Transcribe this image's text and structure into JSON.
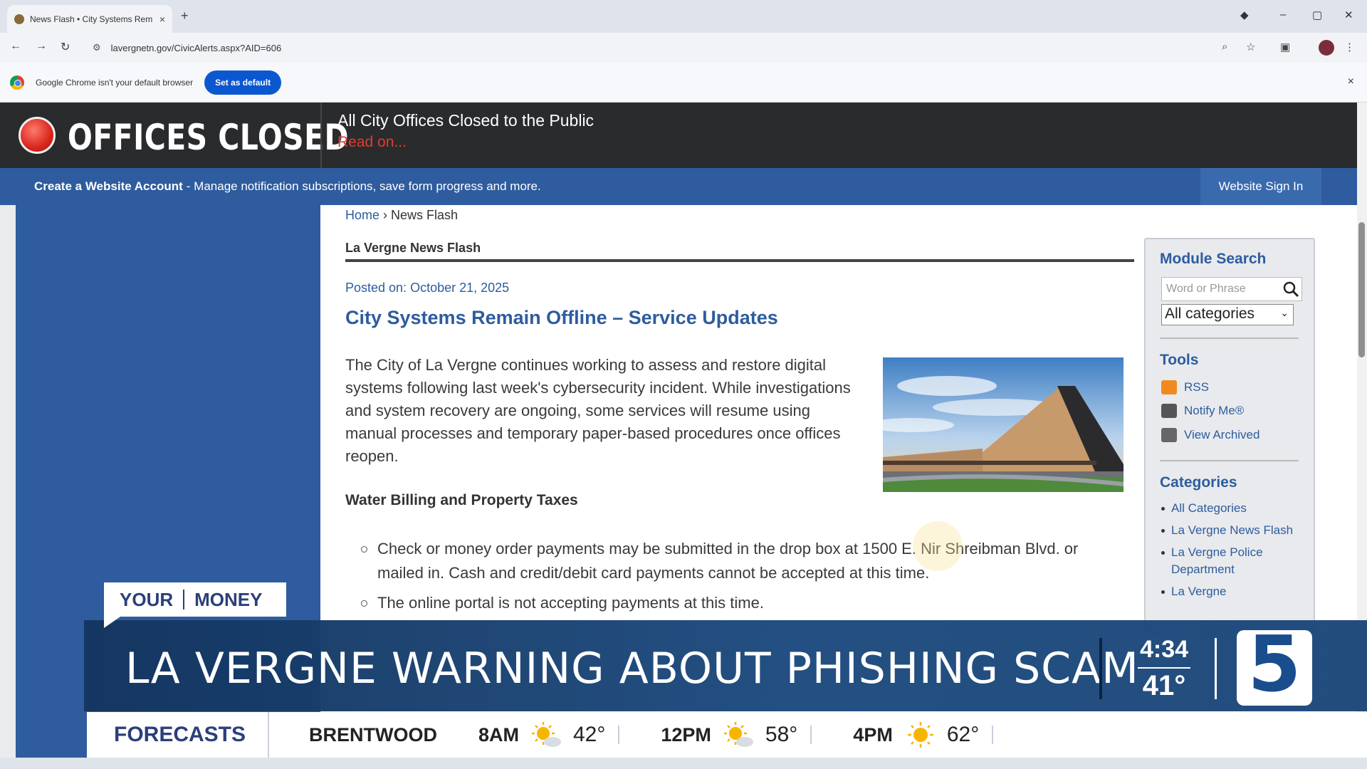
{
  "browser": {
    "tab_title": "News Flash • City Systems Rem",
    "tab_close": "×",
    "new_tab": "+",
    "url": "lavergnetn.gov/CivicAlerts.aspx?AID=606",
    "infobar_message": "Google Chrome isn't your default browser",
    "infobar_button": "Set as default",
    "infobar_close": "×"
  },
  "alert": {
    "title": "OFFICES CLOSED",
    "headline": "All City Offices Closed to the Public",
    "read_on": "Read on..."
  },
  "account_bar": {
    "create": "Create a Website Account",
    "description": "- Manage notification subscriptions, save form progress and more.",
    "sign_in": "Website Sign In"
  },
  "breadcrumb": {
    "home": "Home",
    "separator": "›",
    "current": "News Flash"
  },
  "article": {
    "section": "La Vergne News Flash",
    "posted": "Posted on: October 21, 2025",
    "title": "City Systems Remain Offline – Service Updates",
    "intro": "The City of La Vergne continues working to assess and restore digital systems following last week's cybersecurity incident. While investigations and system recovery are ongoing, some services will resume using manual processes and temporary paper-based procedures once offices reopen.",
    "subhead": "Water Billing and Property Taxes",
    "bullets": [
      "Check or money order payments may be submitted in the drop box at 1500 E. Nir Shreibman Blvd. or mailed in. Cash and credit/debit card payments cannot be accepted at this time.",
      "The online portal is not accepting payments at this time."
    ]
  },
  "sidebar": {
    "module_search": "Module Search",
    "search_placeholder": "Word or Phrase",
    "category_select": "All categories",
    "tools_heading": "Tools",
    "tools": [
      "RSS",
      "Notify Me®",
      "View Archived"
    ],
    "categories_heading": "Categories",
    "categories": [
      "All Categories",
      "La Vergne News Flash",
      "La Vergne Police Department",
      "La Vergne"
    ]
  },
  "broadcast": {
    "badge_left": "YOUR",
    "badge_right": "MONEY",
    "headline": "LA VERGNE WARNING ABOUT PHISHING SCAM",
    "time": "4:34",
    "temperature": "41°",
    "channel": "5",
    "ticker_label": "FORECASTS",
    "ticker_city": "BRENTWOOD",
    "forecast": [
      {
        "hour": "8AM",
        "temp": "42°",
        "icon": "partly-sunny-icon"
      },
      {
        "hour": "12PM",
        "temp": "58°",
        "icon": "partly-sunny-icon"
      },
      {
        "hour": "4PM",
        "temp": "62°",
        "icon": "sunny-icon"
      }
    ]
  },
  "colors": {
    "site_blue": "#2e5c9e",
    "alert_red": "#e03c2f",
    "lowerthird_navy": "#14355f"
  }
}
